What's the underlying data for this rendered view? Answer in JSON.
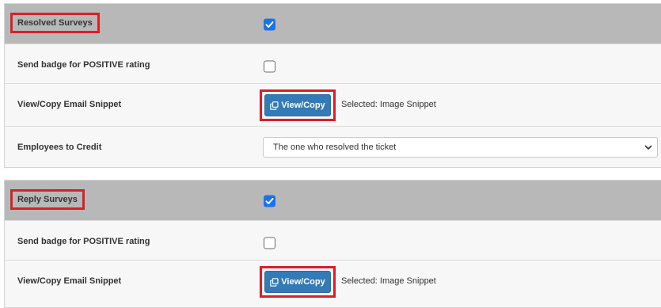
{
  "resolved": {
    "title": "Resolved Surveys",
    "enabled": true,
    "badge_label": "Send badge for POSITIVE rating",
    "badge_checked": false,
    "snippet_label": "View/Copy Email Snippet",
    "snippet_button": "View/Copy",
    "snippet_selected": "Selected: Image Snippet",
    "credit_label": "Employees to Credit",
    "credit_value": "The one who resolved the ticket"
  },
  "reply": {
    "title": "Reply Surveys",
    "enabled": true,
    "badge_label": "Send badge for POSITIVE rating",
    "badge_checked": false,
    "snippet_label": "View/Copy Email Snippet",
    "snippet_button": "View/Copy",
    "snippet_selected": "Selected: Image Snippet"
  },
  "colors": {
    "header_bg": "#b8b8b8",
    "checkbox_checked": "#1a73e8",
    "button_bg": "#337ab7",
    "highlight_border": "#d8202a"
  }
}
